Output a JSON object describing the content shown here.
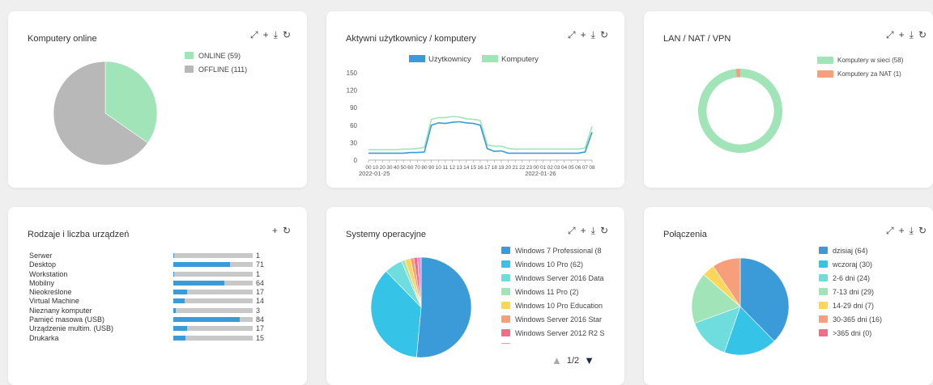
{
  "toolbar_icons": [
    "expand-icon",
    "add-icon",
    "download-icon",
    "refresh-icon"
  ],
  "cards": {
    "online": {
      "title": "Komputery online",
      "legend": [
        {
          "label": "ONLINE (59)",
          "color": "#a0e4b8"
        },
        {
          "label": "OFFLINE (111)",
          "color": "#b8b8b8"
        }
      ]
    },
    "active": {
      "title": "Aktywni użytkownicy / komputery",
      "legend": [
        {
          "label": "Użytkownicy",
          "color": "#3a9bd8"
        },
        {
          "label": "Komputery",
          "color": "#a0e4b8"
        }
      ]
    },
    "lan": {
      "title": "LAN / NAT / VPN",
      "legend": [
        {
          "label": "Komputery w sieci (58)",
          "color": "#a0e4b8"
        },
        {
          "label": "Komputery za NAT (1)",
          "color": "#f79e7b"
        }
      ]
    },
    "devices": {
      "title": "Rodzaje i liczba urządzeń",
      "max": 100,
      "items": [
        {
          "name": "Serwer",
          "value": "1",
          "n": 1
        },
        {
          "name": "Desktop",
          "value": "71",
          "n": 71
        },
        {
          "name": "Workstation",
          "value": "1",
          "n": 1
        },
        {
          "name": "Mobilny",
          "value": "64",
          "n": 64
        },
        {
          "name": "Nieokreślone",
          "value": "17",
          "n": 17
        },
        {
          "name": "Virtual Machine",
          "value": "14",
          "n": 14
        },
        {
          "name": "Nieznany komputer",
          "value": "3",
          "n": 3
        },
        {
          "name": "Pamięć masowa (USB)",
          "value": "84",
          "n": 84
        },
        {
          "name": "Urządzenie multim. (USB)",
          "value": "17",
          "n": 17
        },
        {
          "name": "Drukarka",
          "value": "15",
          "n": 15
        }
      ]
    },
    "os": {
      "title": "Systemy operacyjne",
      "legend": [
        {
          "label": "Windows 7 Professional (8",
          "color": "#3a9bd8"
        },
        {
          "label": "Windows 10 Pro (62)",
          "color": "#36c3e8"
        },
        {
          "label": "Windows Server 2016 Data",
          "color": "#6fdddd"
        },
        {
          "label": "Windows 11 Pro (2)",
          "color": "#a0e4b8"
        },
        {
          "label": "Windows 10 Pro Education",
          "color": "#fcd65a"
        },
        {
          "label": "Windows Server 2016 Star",
          "color": "#f79e7b"
        },
        {
          "label": "Windows Server 2012 R2 S",
          "color": "#f06d85"
        },
        {
          "label": "",
          "color": "#e28fe2"
        }
      ],
      "pager": "1/2"
    },
    "conn": {
      "title": "Połączenia",
      "legend": [
        {
          "label": "dzisiaj (64)",
          "color": "#3a9bd8"
        },
        {
          "label": "wczoraj (30)",
          "color": "#36c3e8"
        },
        {
          "label": "2-6 dni (24)",
          "color": "#6fdddd"
        },
        {
          "label": "7-13 dni (29)",
          "color": "#a0e4b8"
        },
        {
          "label": "14-29 dni (7)",
          "color": "#fcd65a"
        },
        {
          "label": "30-365 dni (16)",
          "color": "#f79e7b"
        },
        {
          "label": ">365 dni (0)",
          "color": "#f06d85"
        }
      ]
    }
  },
  "chart_data": [
    {
      "type": "pie",
      "labels": [
        "ONLINE (59)",
        "OFFLINE (111)"
      ],
      "values": [
        59,
        111
      ],
      "colors": [
        "#a0e4b8",
        "#b8b8b8"
      ]
    },
    {
      "type": "line",
      "yticks": [
        "150",
        "120",
        "90",
        "60",
        "30",
        "0"
      ],
      "ylim": [
        0,
        150
      ],
      "xlabels": [
        "00",
        "10",
        "20",
        "30",
        "40",
        "50",
        "60",
        "70",
        "80",
        "90",
        "10",
        "11",
        "12",
        "13",
        "14",
        "15",
        "16",
        "17",
        "18",
        "19",
        "20",
        "21",
        "22",
        "23",
        "00",
        "01",
        "02",
        "03",
        "04",
        "05",
        "06",
        "07",
        "08"
      ],
      "dates": [
        "2022-01-25",
        "2022-01-26"
      ],
      "series": [
        {
          "name": "Użytkownicy",
          "color": "#3a9bd8",
          "values": [
            12,
            12,
            12,
            12,
            12,
            12,
            13,
            13,
            14,
            60,
            64,
            63,
            65,
            66,
            64,
            63,
            60,
            20,
            15,
            16,
            12,
            12,
            12,
            12,
            12,
            12,
            12,
            12,
            12,
            12,
            12,
            14,
            48
          ]
        },
        {
          "name": "Komputery",
          "color": "#a0e4b8",
          "values": [
            18,
            18,
            18,
            18,
            18,
            19,
            19,
            20,
            22,
            70,
            73,
            73,
            75,
            74,
            71,
            70,
            68,
            26,
            24,
            24,
            20,
            19,
            19,
            19,
            19,
            19,
            19,
            19,
            19,
            19,
            19,
            21,
            58
          ]
        }
      ]
    },
    {
      "type": "pie",
      "labels": [
        "Komputery w sieci (58)",
        "Komputery za NAT (1)"
      ],
      "values": [
        58,
        1
      ],
      "colors": [
        "#a0e4b8",
        "#f79e7b"
      ]
    },
    {
      "type": "bar",
      "categories": [
        "Serwer",
        "Desktop",
        "Workstation",
        "Mobilny",
        "Nieokreślone",
        "Virtual Machine",
        "Nieznany komputer",
        "Pamięć masowa (USB)",
        "Urządzenie multim. (USB)",
        "Drukarka"
      ],
      "values": [
        1,
        71,
        1,
        64,
        17,
        14,
        3,
        84,
        17,
        15
      ]
    },
    {
      "type": "pie",
      "values": [
        88,
        62,
        10,
        2,
        3,
        2,
        2,
        2
      ],
      "colors": [
        "#3a9bd8",
        "#36c3e8",
        "#6fdddd",
        "#a0e4b8",
        "#fcd65a",
        "#f79e7b",
        "#f06d85",
        "#e28fe2"
      ]
    },
    {
      "type": "pie",
      "labels": [
        "dzisiaj (64)",
        "wczoraj (30)",
        "2-6 dni (24)",
        "7-13 dni (29)",
        "14-29 dni (7)",
        "30-365 dni (16)",
        ">365 dni (0)"
      ],
      "values": [
        64,
        30,
        24,
        29,
        7,
        16,
        0
      ],
      "colors": [
        "#3a9bd8",
        "#36c3e8",
        "#6fdddd",
        "#a0e4b8",
        "#fcd65a",
        "#f79e7b",
        "#f06d85"
      ]
    }
  ]
}
